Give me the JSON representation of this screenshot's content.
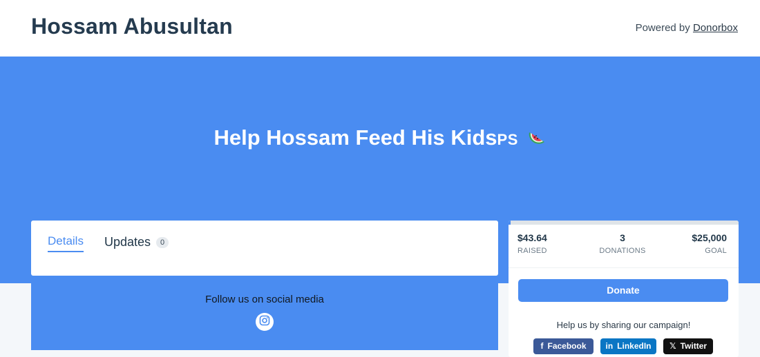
{
  "header": {
    "org_name": "Hossam Abusultan",
    "powered_prefix": "Powered by",
    "powered_link": "Donorbox"
  },
  "hero": {
    "title": "Help Hossam Feed His Kids",
    "title_suffix": "PS",
    "emoji_icon": "watermelon-icon",
    "background_color": "#4a8cf1"
  },
  "tabs": {
    "details_label": "Details",
    "updates_label": "Updates",
    "updates_count": "0"
  },
  "social": {
    "label": "Follow us on social media",
    "icon": "instagram-icon"
  },
  "stats": {
    "raised_value": "$43.64",
    "raised_label": "RAISED",
    "donations_value": "3",
    "donations_label": "DONATIONS",
    "goal_value": "$25,000",
    "goal_label": "GOAL",
    "progress_fraction": 0.0017
  },
  "donate": {
    "button_label": "Donate"
  },
  "share": {
    "prompt": "Help us by sharing our campaign!",
    "facebook_label": "Facebook",
    "linkedin_label": "LinkedIn",
    "twitter_label": "Twitter"
  },
  "colors": {
    "accent": "#4a8cf1",
    "facebook": "#3b5998",
    "linkedin": "#0a76c4",
    "twitter": "#111111"
  }
}
